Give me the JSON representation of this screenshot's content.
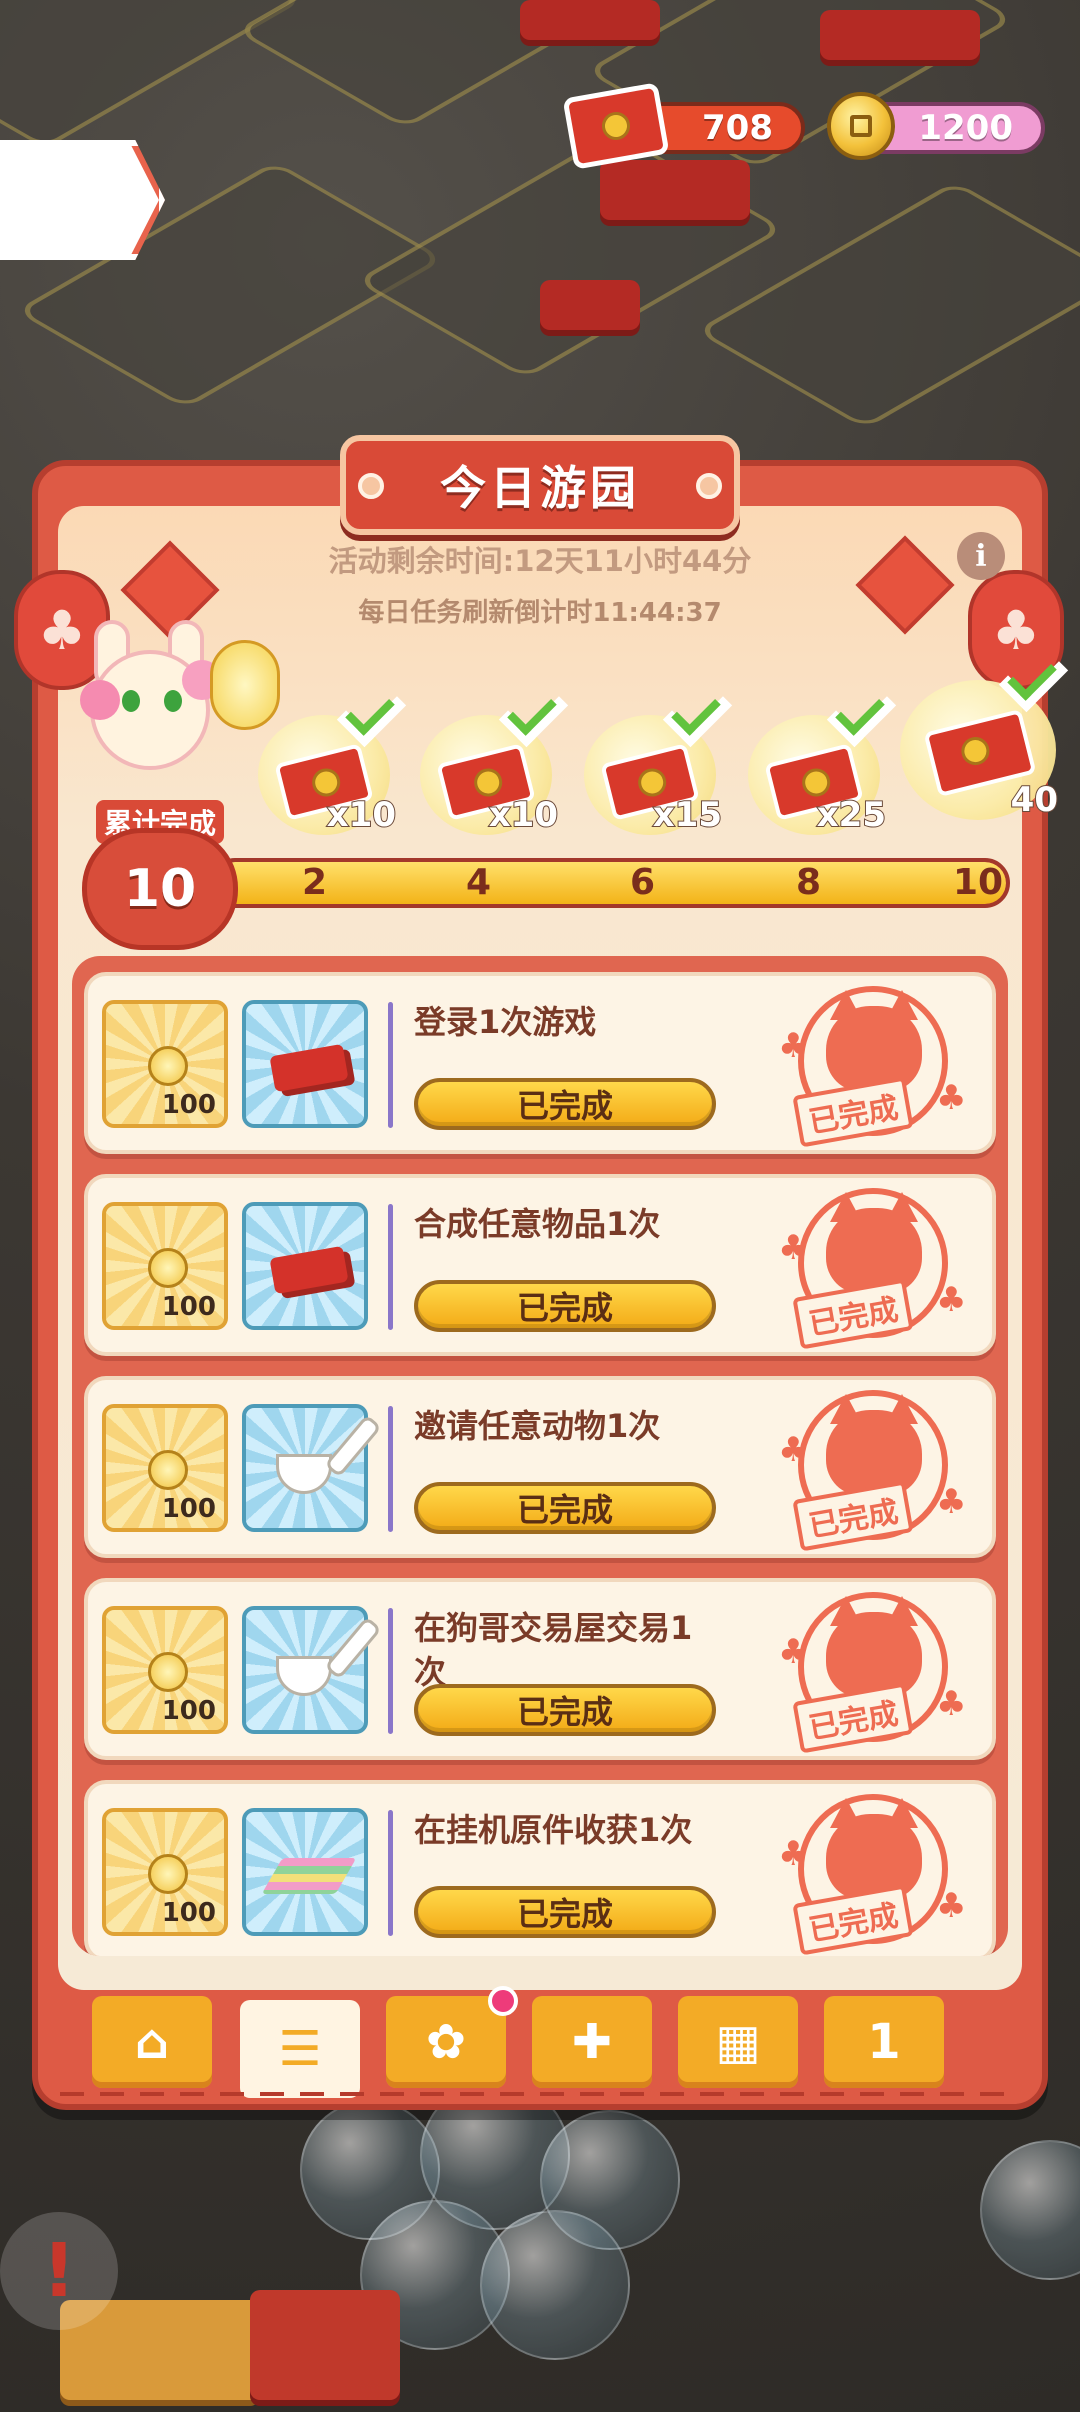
{
  "currency": {
    "tickets": "708",
    "coins": "1200"
  },
  "panel": {
    "title": "今日游园",
    "remaining_time": "活动剩余时间:12天11小时44分",
    "refresh_countdown": "每日任务刷新倒计时11:44:37",
    "info_icon": "i"
  },
  "milestones": {
    "label": "累计完成",
    "completed": "10",
    "progress_fraction": 1.0,
    "ticks": [
      "2",
      "4",
      "6",
      "8",
      "10"
    ],
    "rewards": [
      {
        "qty": "x10",
        "claimed": true
      },
      {
        "qty": "x10",
        "claimed": true
      },
      {
        "qty": "x15",
        "claimed": true
      },
      {
        "qty": "x25",
        "claimed": true
      },
      {
        "qty": "40",
        "claimed": true
      }
    ]
  },
  "tasks": [
    {
      "name": "登录1次游戏",
      "coin_reward": "100",
      "item_icon": "red-envelope-icon",
      "button": "已完成",
      "stamp": "已完成"
    },
    {
      "name": "合成任意物品1次",
      "coin_reward": "100",
      "item_icon": "red-envelope-icon",
      "button": "已完成",
      "stamp": "已完成"
    },
    {
      "name": "邀请任意动物1次",
      "coin_reward": "100",
      "item_icon": "ladle-icon",
      "button": "已完成",
      "stamp": "已完成"
    },
    {
      "name": "在狗哥交易屋交易1次",
      "coin_reward": "100",
      "item_icon": "ladle-icon",
      "button": "已完成",
      "stamp": "已完成"
    },
    {
      "name": "在挂机原件收获1次",
      "coin_reward": "100",
      "item_icon": "cash-stack-icon",
      "button": "已完成",
      "stamp": "已完成"
    }
  ],
  "tabs": [
    {
      "icon": "shop-icon",
      "active": false
    },
    {
      "icon": "task-list-icon",
      "active": true
    },
    {
      "icon": "cat-coins-icon",
      "active": false,
      "badge": true
    },
    {
      "icon": "wheel-icon",
      "active": false
    },
    {
      "icon": "gift-icon",
      "active": false
    },
    {
      "icon": "ranking-icon",
      "active": false,
      "label": "1"
    }
  ],
  "colors": {
    "panel_red": "#de5a45",
    "button_yellow": "#f3ab26",
    "stamp_red": "#ee6c52",
    "check_green": "#62c33d"
  }
}
